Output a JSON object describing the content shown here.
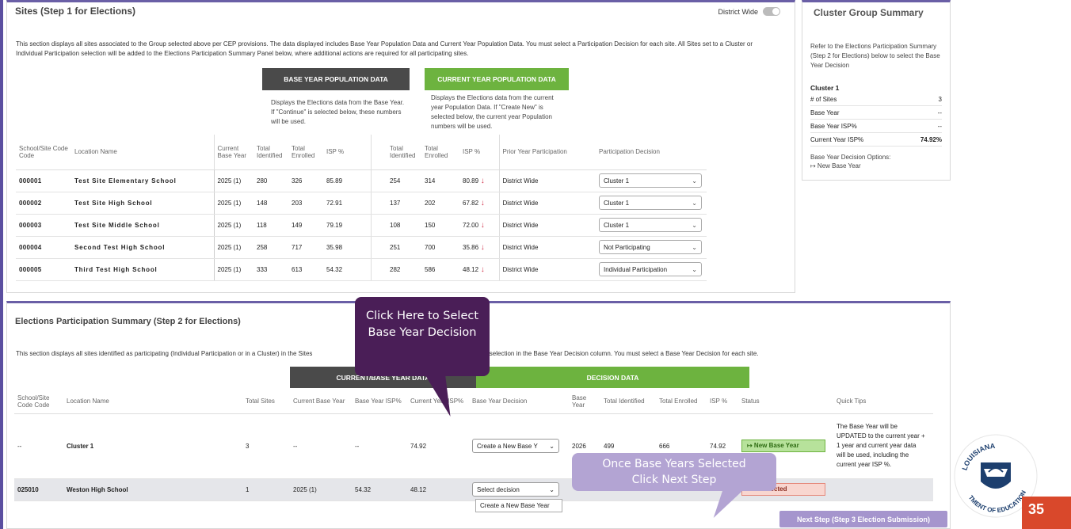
{
  "sites_panel": {
    "title": "Sites (Step 1 for Elections)",
    "district_wide_label": "District Wide",
    "description": "This section displays all sites associated to the Group selected above per CEP provisions. The data displayed includes Base Year Population Data and Current Year Population Data. You must select a Participation Decision for each site. All Sites set to a Cluster or Individual Participation selection will be added to the Elections Participation Summary Panel below, where additional actions are required for all participating sites.",
    "base_header": "BASE YEAR POPULATION DATA",
    "base_desc": "Displays the Elections data from the Base Year. If \"Continue\" is selected below, these numbers will be used.",
    "current_header": "CURRENT YEAR POPULATION DATA",
    "current_desc": "Displays the Elections data from the current year Population Data. If \"Create New\" is selected below, the current year Population numbers will be used.",
    "columns": [
      "School/Site Code Code",
      "Location Name",
      "Current Base Year",
      "Total Identified",
      "Total Enrolled",
      "ISP %",
      "Total Identified",
      "Total Enrolled",
      "ISP %",
      "Prior Year Participation",
      "Participation Decision"
    ],
    "rows": [
      {
        "code": "000001",
        "name": "Test Site Elementary School",
        "base_year": "2025 (1)",
        "b_ident": "280",
        "b_enr": "326",
        "b_isp": "85.89",
        "c_ident": "254",
        "c_enr": "314",
        "c_isp": "80.89",
        "prior": "District Wide",
        "decision": "Cluster 1"
      },
      {
        "code": "000002",
        "name": "Test Site High School",
        "base_year": "2025 (1)",
        "b_ident": "148",
        "b_enr": "203",
        "b_isp": "72.91",
        "c_ident": "137",
        "c_enr": "202",
        "c_isp": "67.82",
        "prior": "District Wide",
        "decision": "Cluster 1"
      },
      {
        "code": "000003",
        "name": "Test Site Middle School",
        "base_year": "2025 (1)",
        "b_ident": "118",
        "b_enr": "149",
        "b_isp": "79.19",
        "c_ident": "108",
        "c_enr": "150",
        "c_isp": "72.00",
        "prior": "District Wide",
        "decision": "Cluster 1"
      },
      {
        "code": "000004",
        "name": "Second Test High School",
        "base_year": "2025 (1)",
        "b_ident": "258",
        "b_enr": "717",
        "b_isp": "35.98",
        "c_ident": "251",
        "c_enr": "700",
        "c_isp": "35.86",
        "prior": "District Wide",
        "decision": "Not Participating"
      },
      {
        "code": "000005",
        "name": "Third Test High School",
        "base_year": "2025 (1)",
        "b_ident": "333",
        "b_enr": "613",
        "b_isp": "54.32",
        "c_ident": "282",
        "c_enr": "586",
        "c_isp": "48.12",
        "prior": "District Wide",
        "decision": "Individual Participation"
      }
    ]
  },
  "cluster_panel": {
    "title": "Cluster Group Summary",
    "text": "Refer to the Elections Participation Summary (Step 2 for Elections) below to select the Base Year Decision",
    "cluster_name": "Cluster 1",
    "sites_label": "# of Sites",
    "sites_value": "3",
    "base_year_label": "Base Year",
    "base_year_value": "--",
    "base_isp_label": "Base Year ISP%",
    "base_isp_value": "--",
    "current_isp_label": "Current Year ISP%",
    "current_isp_value": "74.92%",
    "options_label": "Base Year Decision Options:",
    "options_value": "↦ New Base Year"
  },
  "elections_panel": {
    "title": "Elections Participation Summary (Step 2 for Elections)",
    "description": "This section displays all sites identified as participating (Individual Participation or in a Cluster) in the Sites",
    "description_tail": "will be dependent on your selection in the Base Year Decision column. You must select a Base Year Decision for each site.",
    "current_header": "CURRENT/BASE YEAR DATA",
    "decision_header": "DECISION DATA",
    "columns": [
      "School/Site Code Code",
      "Location Name",
      "Total Sites",
      "Current Base Year",
      "Base Year ISP%",
      "Current Year ISP%",
      "Base Year Decision",
      "Base Year",
      "Total Identified",
      "Total Enrolled",
      "ISP %",
      "Status",
      "Quick Tips"
    ],
    "rows": [
      {
        "code": "--",
        "name": "Cluster 1",
        "sites": "3",
        "cur_base": "--",
        "base_isp": "--",
        "cur_isp": "74.92",
        "decision": "Create a New Base Y",
        "year": "2026",
        "ident": "499",
        "enr": "666",
        "isp": "74.92",
        "status": "↦ New Base Year",
        "tip": "The Base Year will be UPDATED to the current year + 1 year and current year data will be used, including the current year ISP %."
      },
      {
        "code": "025010",
        "name": "Weston High School",
        "sites": "1",
        "cur_base": "2025 (1)",
        "base_isp": "54.32",
        "cur_isp": "48.12",
        "decision": "Select decision",
        "year": "",
        "ident": "",
        "enr": "",
        "isp": "",
        "status": "Not Selected",
        "tip": ""
      }
    ],
    "dropdown_option": "Create a New Base Year",
    "next_button": "Next Step (Step 3 Election Submission)"
  },
  "callouts": {
    "click_here": "Click Here to Select Base Year Decision",
    "once_selected": "Once Base Years Selected Click Next Step"
  },
  "logo": {
    "top_text": "LOUISIANA",
    "bottom_text": "TMENT OF EDUCATION"
  },
  "page_number": "35",
  "colors": {
    "accent_purple": "#6a5fa6",
    "green": "#6db33f",
    "dark_header": "#4a4a4a",
    "callout": "#4a1e57",
    "orange": "#d9482b"
  }
}
